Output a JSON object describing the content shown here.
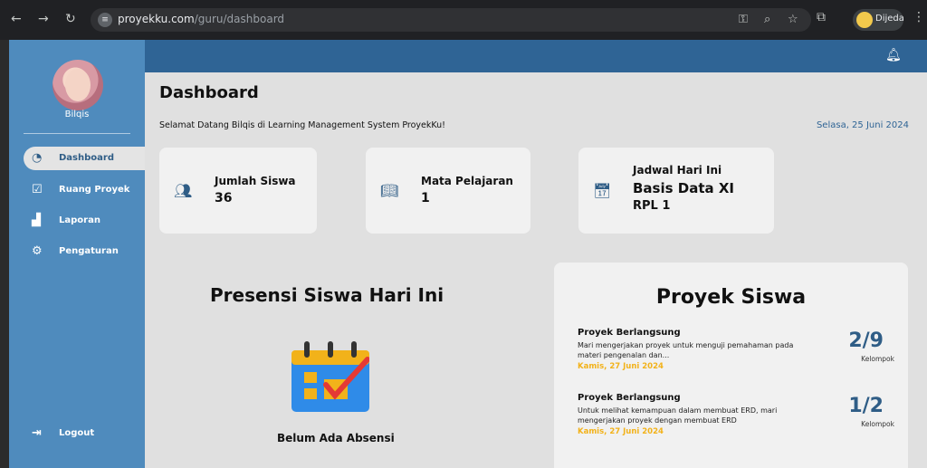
{
  "browser": {
    "url_domain": "proyekku.com",
    "url_path": "/guru/dashboard",
    "profile_name": "Dijeda"
  },
  "sidebar": {
    "user_name": "Bilqis",
    "items": [
      {
        "label": "Dashboard",
        "icon": "dashboard-icon",
        "active": true
      },
      {
        "label": "Ruang Proyek",
        "icon": "clipboard-check-icon",
        "active": false
      },
      {
        "label": "Laporan",
        "icon": "chart-icon",
        "active": false
      },
      {
        "label": "Pengaturan",
        "icon": "gear-icon",
        "active": false
      }
    ],
    "logout_label": "Logout"
  },
  "header": {
    "page_title": "Dashboard",
    "welcome": "Selamat Datang Bilqis di Learning Management System ProyekKu!",
    "date": "Selasa, 25 Juni 2024"
  },
  "stats": {
    "siswa": {
      "title": "Jumlah Siswa",
      "value": "36"
    },
    "mapel": {
      "title": "Mata Pelajaran",
      "value": "1"
    },
    "jadwal": {
      "title": "Jadwal Hari Ini",
      "line1": "Basis Data XI",
      "line2": "RPL 1"
    }
  },
  "presensi": {
    "title": "Presensi Siswa Hari Ini",
    "empty_label": "Belum Ada Absensi"
  },
  "proyek": {
    "title": "Proyek Siswa",
    "items": [
      {
        "status": "Proyek Berlangsung",
        "desc": "Mari mengerjakan proyek untuk menguji pemahaman pada materi pengenalan dan...",
        "date": "Kamis, 27 Juni 2024",
        "count": "2/9",
        "count_label": "Kelompok"
      },
      {
        "status": "Proyek Berlangsung",
        "desc": "Untuk melihat kemampuan dalam membuat ERD, mari mengerjakan proyek dengan membuat ERD",
        "date": "Kamis, 27 Juni 2024",
        "count": "1/2",
        "count_label": "Kelompok"
      }
    ]
  },
  "colors": {
    "sidebar": "#4f8bbd",
    "topbar": "#2f6495",
    "accent_date": "#f2b21a"
  }
}
